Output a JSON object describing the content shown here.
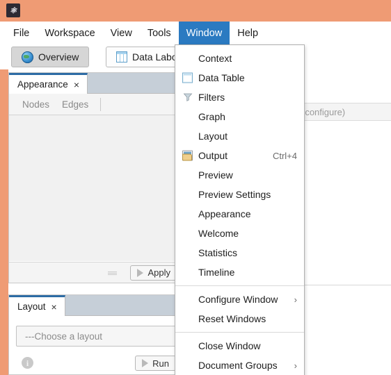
{
  "titlebar": {
    "app_icon": "gephi-logo"
  },
  "menubar": {
    "items": [
      {
        "label": "File",
        "active": false
      },
      {
        "label": "Workspace",
        "active": false
      },
      {
        "label": "View",
        "active": false
      },
      {
        "label": "Tools",
        "active": false
      },
      {
        "label": "Window",
        "active": true
      },
      {
        "label": "Help",
        "active": false
      }
    ],
    "active_color": "#2b7ac1"
  },
  "mode_tabs": {
    "overview": {
      "label": "Overview",
      "icon": "globe-icon",
      "selected": true
    },
    "data_laboratory": {
      "label": "Data Laboratory",
      "icon": "table-icon",
      "selected": false
    }
  },
  "appearance_panel": {
    "tab_label": "Appearance",
    "close": "×",
    "subtabs": [
      "Nodes",
      "Edges"
    ],
    "apply_button": "Apply"
  },
  "layout_panel": {
    "tab_label": "Layout",
    "close": "×",
    "combo_value": "---Choose a layout",
    "run_button": "Run",
    "info_icon": "info-icon"
  },
  "right_content": {
    "configure_text": "(configure)"
  },
  "window_menu": {
    "items": [
      {
        "label": "Context",
        "icon": null,
        "accel": "",
        "arrow": ""
      },
      {
        "label": "Data Table",
        "icon": "table-icon",
        "accel": "",
        "arrow": ""
      },
      {
        "label": "Filters",
        "icon": "filter-icon",
        "accel": "",
        "arrow": ""
      },
      {
        "label": "Graph",
        "icon": null,
        "accel": "",
        "arrow": ""
      },
      {
        "label": "Layout",
        "icon": null,
        "accel": "",
        "arrow": ""
      },
      {
        "label": "Output",
        "icon": "output-icon",
        "accel": "Ctrl+4",
        "arrow": ""
      },
      {
        "label": "Preview",
        "icon": null,
        "accel": "",
        "arrow": ""
      },
      {
        "label": "Preview Settings",
        "icon": null,
        "accel": "",
        "arrow": ""
      },
      {
        "label": "Appearance",
        "icon": null,
        "accel": "",
        "arrow": ""
      },
      {
        "label": "Welcome",
        "icon": null,
        "accel": "",
        "arrow": ""
      },
      {
        "label": "Statistics",
        "icon": null,
        "accel": "",
        "arrow": ""
      },
      {
        "label": "Timeline",
        "icon": null,
        "accel": "",
        "arrow": ""
      },
      {
        "label": "Configure Window",
        "icon": null,
        "accel": "",
        "arrow": "›"
      },
      {
        "label": "Reset Windows",
        "icon": null,
        "accel": "",
        "arrow": ""
      },
      {
        "label": "Close Window",
        "icon": null,
        "accel": "",
        "arrow": ""
      },
      {
        "label": "Document Groups",
        "icon": null,
        "accel": "",
        "arrow": "›"
      }
    ],
    "separator_after": [
      11,
      13
    ]
  },
  "colors": {
    "titlebar": "#ef9b74",
    "menu_highlight": "#2b7ac1",
    "panel_tab_accent": "#2d6ca5",
    "panel_tabrow": "#c6cfd8"
  }
}
